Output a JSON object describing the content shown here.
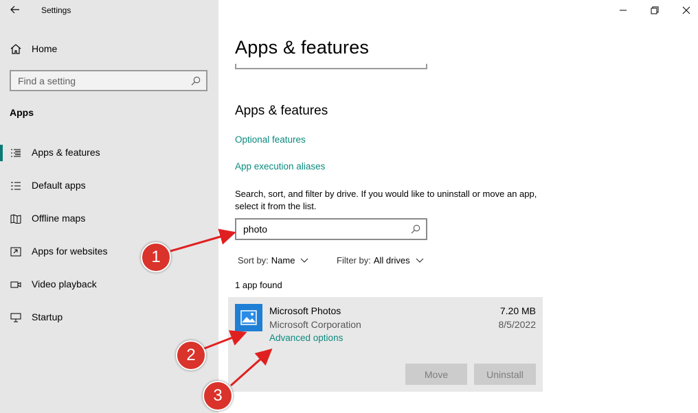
{
  "window": {
    "title": "Settings",
    "controls": {
      "minimize_icon": "minimize-icon",
      "maximize_icon": "restore-icon",
      "close_icon": "close-icon"
    }
  },
  "sidebar": {
    "home_label": "Home",
    "search_placeholder": "Find a setting",
    "section_label": "Apps",
    "items": [
      {
        "label": "Apps & features",
        "icon": "list-icon",
        "active": true
      },
      {
        "label": "Default apps",
        "icon": "default-apps-icon",
        "active": false
      },
      {
        "label": "Offline maps",
        "icon": "map-icon",
        "active": false
      },
      {
        "label": "Apps for websites",
        "icon": "open-window-icon",
        "active": false
      },
      {
        "label": "Video playback",
        "icon": "video-icon",
        "active": false
      },
      {
        "label": "Startup",
        "icon": "startup-icon",
        "active": false
      }
    ]
  },
  "main": {
    "page_title": "Apps & features",
    "section_title": "Apps & features",
    "links": [
      "Optional features",
      "App execution aliases"
    ],
    "description": "Search, sort, and filter by drive. If you would like to uninstall or move an app, select it from the list.",
    "search_value": "photo",
    "sort_label": "Sort by:",
    "sort_value": "Name",
    "filter_label": "Filter by:",
    "filter_value": "All drives",
    "found_text": "1 app found",
    "app": {
      "name": "Microsoft Photos",
      "publisher": "Microsoft Corporation",
      "advanced_link": "Advanced options",
      "size": "7.20 MB",
      "date": "8/5/2022",
      "move_label": "Move",
      "uninstall_label": "Uninstall"
    }
  },
  "annotations": {
    "badges": [
      "1",
      "2",
      "3"
    ],
    "color": "#d9332b"
  },
  "colors": {
    "accent": "#0a8a7e",
    "sidebar_bg": "#e6e6e6",
    "card_bg": "#e8e8e8"
  }
}
